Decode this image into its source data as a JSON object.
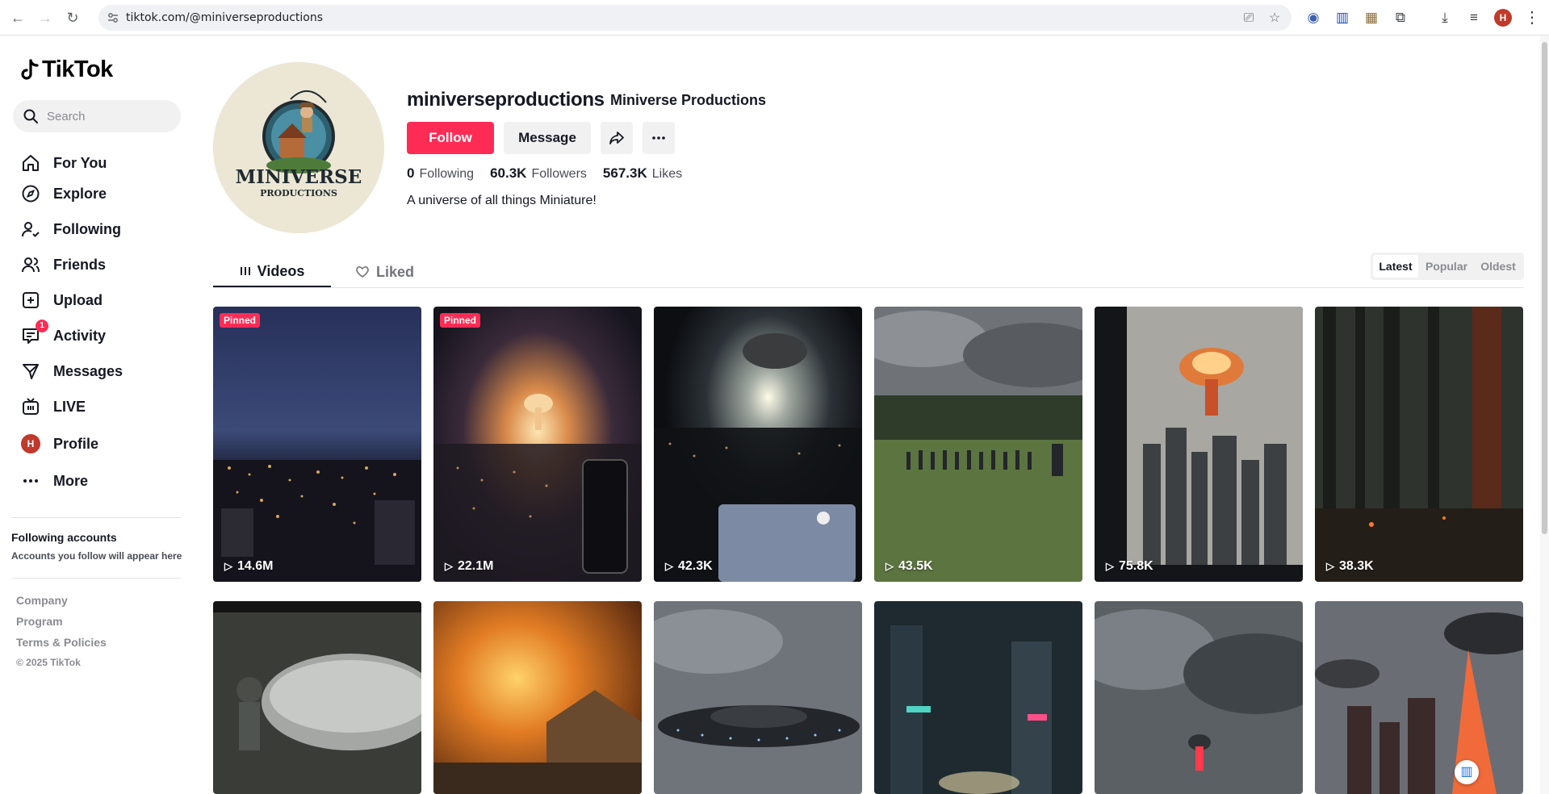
{
  "browser": {
    "url": "tiktok.com/@miniverseproductions"
  },
  "sidebar": {
    "logo_text": "TikTok",
    "search_placeholder": "Search",
    "nav": [
      {
        "label": "For You",
        "icon": "home-icon"
      },
      {
        "label": "Explore",
        "icon": "compass-icon"
      },
      {
        "label": "Following",
        "icon": "following-icon"
      },
      {
        "label": "Friends",
        "icon": "friends-icon"
      },
      {
        "label": "Upload",
        "icon": "upload-icon"
      },
      {
        "label": "Activity",
        "icon": "activity-icon",
        "badge": "1"
      },
      {
        "label": "Messages",
        "icon": "messages-icon"
      },
      {
        "label": "LIVE",
        "icon": "live-icon"
      },
      {
        "label": "Profile",
        "icon": "profile-avatar",
        "avatar_letter": "H"
      },
      {
        "label": "More",
        "icon": "more-icon"
      }
    ],
    "following_title": "Following accounts",
    "following_sub": "Accounts you follow will appear here",
    "footer_links": [
      "Company",
      "Program",
      "Terms & Policies"
    ],
    "copyright": "© 2025 TikTok"
  },
  "profile": {
    "username": "miniverseproductions",
    "display_name": "Miniverse Productions",
    "avatar_text_main": "MINIVERSE",
    "avatar_text_sub": "PRODUCTIONS",
    "follow_label": "Follow",
    "message_label": "Message",
    "stats": {
      "following_count": "0",
      "following_label": "Following",
      "followers_count": "60.3K",
      "followers_label": "Followers",
      "likes_count": "567.3K",
      "likes_label": "Likes"
    },
    "bio": "A universe of all things Miniature!"
  },
  "tabs": {
    "videos": "Videos",
    "liked": "Liked",
    "sort": [
      "Latest",
      "Popular",
      "Oldest"
    ],
    "sort_active": "Latest"
  },
  "videos": [
    {
      "views": "14.6M",
      "pinned": "Pinned"
    },
    {
      "views": "22.1M",
      "pinned": "Pinned"
    },
    {
      "views": "42.3K"
    },
    {
      "views": "43.5K"
    },
    {
      "views": "75.8K"
    },
    {
      "views": "38.3K"
    }
  ],
  "colors": {
    "accent": "#fe2c55",
    "text": "#161823"
  }
}
